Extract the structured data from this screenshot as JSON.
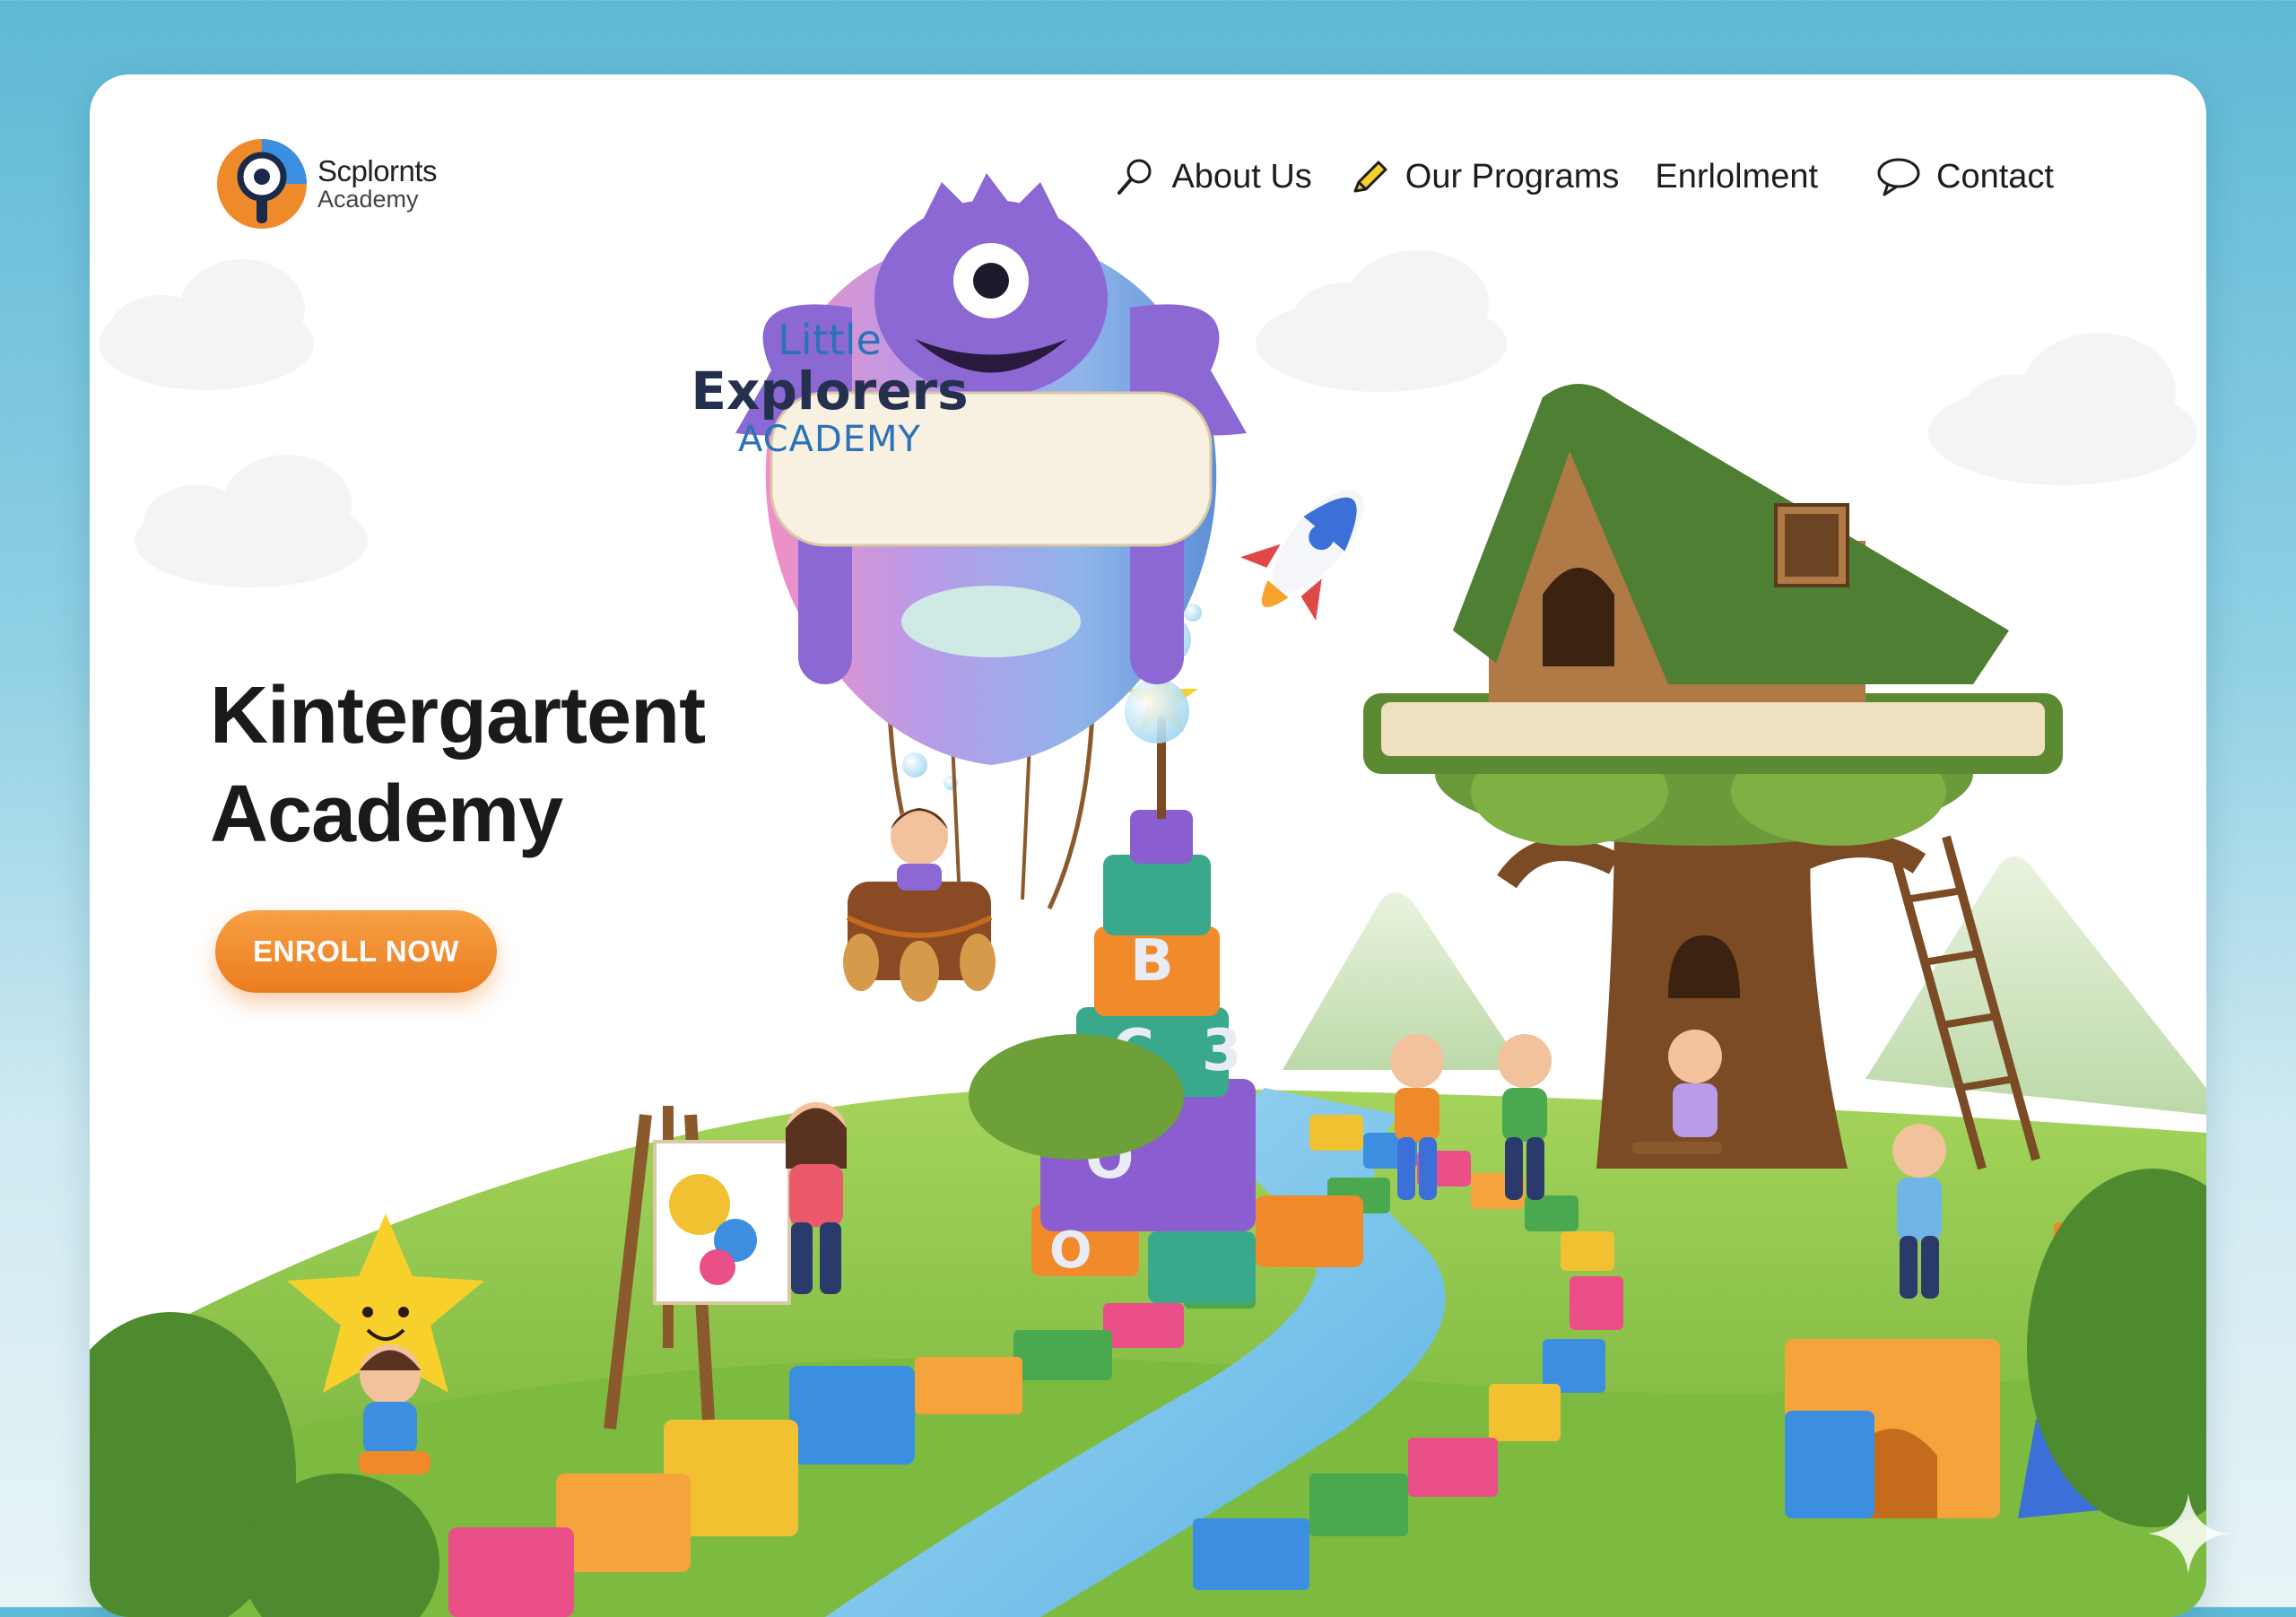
{
  "brand": {
    "name": "Scplornts",
    "sub": "Academy"
  },
  "nav": {
    "items": [
      {
        "label": "About Us",
        "icon": "magnifier-icon"
      },
      {
        "label": "Our Programs",
        "icon": "pencil-icon"
      },
      {
        "label": "Enrlolment",
        "icon": ""
      },
      {
        "label": "Contact",
        "icon": "speech-bubble-icon"
      }
    ]
  },
  "hero": {
    "title_line1": "Kintergartent",
    "title_line2": "Academy",
    "cta_label": "ENROLL NOW"
  },
  "balloon": {
    "line1": "Little",
    "line2": "Explorers",
    "line3": "ACADEMY"
  },
  "blocks": {
    "letters": [
      "B",
      "C",
      "3",
      "O",
      "O"
    ]
  },
  "colors": {
    "accent_orange": "#ef8a2b",
    "grass_green": "#8cc04a",
    "river_blue": "#7ec6ea",
    "monster_purple": "#8b68d3"
  }
}
